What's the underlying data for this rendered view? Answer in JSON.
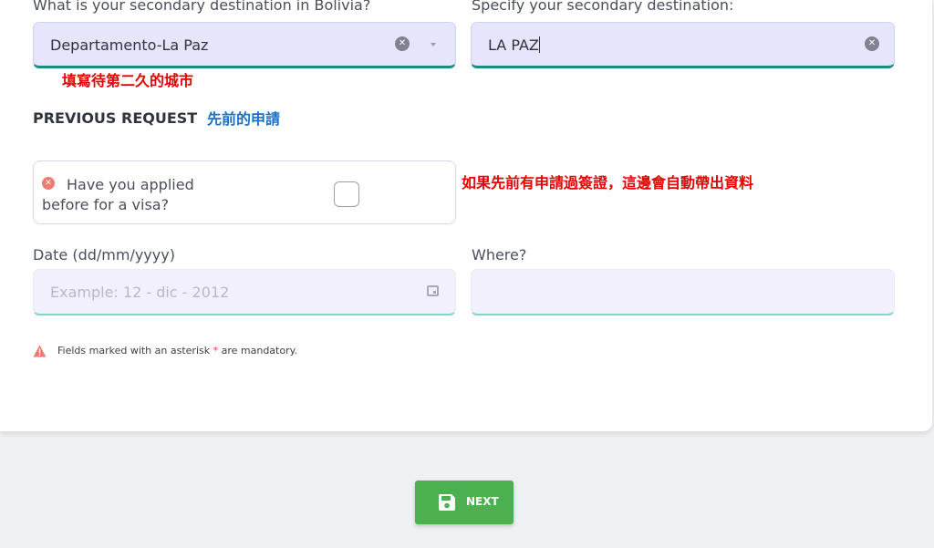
{
  "form": {
    "secondary_destination": {
      "label": "What is your secondary destination in Bolivia?",
      "value": "Departamento-La Paz",
      "note": "填寫待第二久的城市"
    },
    "specify_destination": {
      "label": "Specify your secondary destination:",
      "value": "LA PAZ"
    },
    "previous_request": {
      "title": "PREVIOUS REQUEST",
      "note": "先前的申請"
    },
    "visa_applied": {
      "line1": "Have you applied",
      "line2": "before for a visa?",
      "checked": false,
      "note": "如果先前有申請過簽證，這邊會自動帶出資料"
    },
    "date": {
      "label": "Date (dd/mm/yyyy)",
      "placeholder": "Example: 12 - dic - 2012"
    },
    "where": {
      "label": "Where?",
      "value": ""
    },
    "mandatory_note": {
      "text": "Fields marked with an asterisk",
      "star": "*",
      "suffix": "are mandatory."
    }
  },
  "actions": {
    "next_label": "NEXT"
  },
  "icons": {
    "clear": "clear-circle-icon",
    "dropdown": "chevron-down-icon",
    "error": "error-circle-icon",
    "calendar": "calendar-icon",
    "warning": "warning-triangle-icon",
    "save": "floppy-disk-icon"
  },
  "colors": {
    "field_bg": "#e5e5fb",
    "field_underline": "#1f8a7d",
    "annotation_red": "#e60000",
    "annotation_blue": "#1c6fc7",
    "next_button": "#4caf50"
  }
}
